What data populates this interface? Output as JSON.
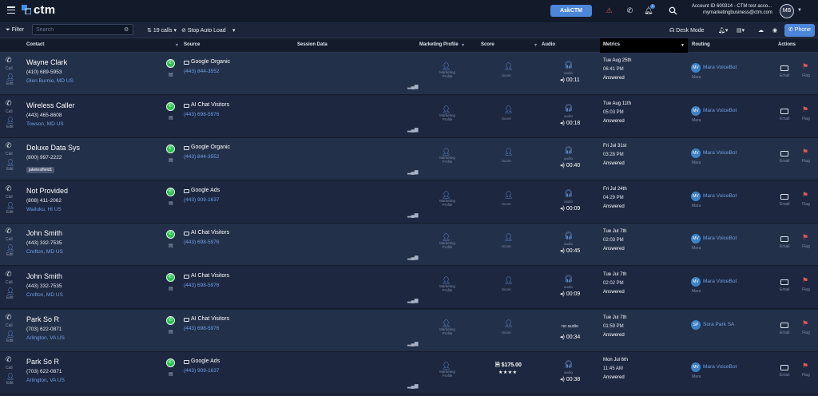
{
  "topbar": {
    "logo_text": "ctm",
    "askctm_label": "AskCTM",
    "notification_count": "1",
    "account_line1": "Account ID 600314 - CTM test acco...",
    "account_line2": "mymarketingbusiness@ctm.com",
    "avatar_initials": "MB"
  },
  "filterbar": {
    "filter_label": "Filter",
    "search_placeholder": "Search",
    "calls_count": "19 calls",
    "stop_auto_load": "Stop Auto Load",
    "desk_mode": "Desk Mode",
    "phone_label": "Phone"
  },
  "columns": {
    "contact": "Contact",
    "source": "Source",
    "session": "Session Data",
    "marketing": "Marketing Profile",
    "score": "Score",
    "audio": "Audio",
    "metrics": "Metrics",
    "routing": "Routing",
    "actions": "Actions"
  },
  "labels": {
    "call": "Call",
    "edit": "Edit",
    "marketing_profile": "Marketing Profile",
    "score": "Score",
    "audio": "audio",
    "no_audio": "no audio",
    "email": "Email",
    "flag": "Flag"
  },
  "rows": [
    {
      "name": "Wayne Clark",
      "phone": "(410) 689-5953",
      "location": "Glen Burnie, MD US",
      "tag": "",
      "source": "Google Organic",
      "source_number": "(443) 844-3552",
      "score_amount": "",
      "has_audio": true,
      "duration": "00:11",
      "date": "Tue Aug 25th",
      "time": "06:41 PM",
      "status": "Answered",
      "routing_initials": "MV",
      "routing_name": "Mara VoiceBot",
      "routing_sub": "Mara"
    },
    {
      "name": "Wireless Caller",
      "phone": "(443) 465-8608",
      "location": "Towson, MD US",
      "tag": "",
      "source": "AI Chat Visitors",
      "source_number": "(443) 698-5976",
      "score_amount": "",
      "has_audio": true,
      "duration": "00:18",
      "date": "Tue Aug 11th",
      "time": "05:03 PM",
      "status": "Answered",
      "routing_initials": "MV",
      "routing_name": "Mara VoiceBot",
      "routing_sub": "Mara"
    },
    {
      "name": "Deluxe Data Sys",
      "phone": "(800) 997-2222",
      "location": "",
      "tag": "jaketestfield1",
      "source": "Google Organic",
      "source_number": "(443) 844-3552",
      "score_amount": "",
      "has_audio": true,
      "duration": "00:40",
      "date": "Fri Jul 31st",
      "time": "03:28 PM",
      "status": "Answered",
      "routing_initials": "MV",
      "routing_name": "Mara VoiceBot",
      "routing_sub": "Mara"
    },
    {
      "name": "Not Provided",
      "phone": "(808) 411-2062",
      "location": "Wailuku, HI US",
      "tag": "",
      "source": "Google Ads",
      "source_number": "(443) 909-1637",
      "score_amount": "",
      "has_audio": true,
      "duration": "00:09",
      "date": "Fri Jul 24th",
      "time": "04:29 PM",
      "status": "Answered",
      "routing_initials": "MV",
      "routing_name": "Mara VoiceBot",
      "routing_sub": "Mara"
    },
    {
      "name": "John Smith",
      "phone": "(443) 332-7535",
      "location": "Crofton, MD US",
      "tag": "",
      "source": "AI Chat Visitors",
      "source_number": "(443) 698-5976",
      "score_amount": "",
      "has_audio": true,
      "duration": "00:45",
      "date": "Tue Jul 7th",
      "time": "02:03 PM",
      "status": "Answered",
      "routing_initials": "MV",
      "routing_name": "Mara VoiceBot",
      "routing_sub": "Mara"
    },
    {
      "name": "John Smith",
      "phone": "(443) 332-7535",
      "location": "Crofton, MD US",
      "tag": "",
      "source": "AI Chat Visitors",
      "source_number": "(443) 698-5976",
      "score_amount": "",
      "has_audio": true,
      "duration": "00:09",
      "date": "Tue Jul 7th",
      "time": "02:02 PM",
      "status": "Answered",
      "routing_initials": "MV",
      "routing_name": "Mara VoiceBot",
      "routing_sub": "Mara"
    },
    {
      "name": "Park So R",
      "phone": "(703) 622-0871",
      "location": "Arlington, VA US",
      "tag": "",
      "source": "AI Chat Visitors",
      "source_number": "(443) 698-5976",
      "score_amount": "",
      "has_audio": false,
      "duration": "00:34",
      "date": "Tue Jul 7th",
      "time": "01:59 PM",
      "status": "Answered",
      "routing_initials": "SP",
      "routing_name": "Sora Park SA",
      "routing_sub": ""
    },
    {
      "name": "Park So R",
      "phone": "(703) 622-0871",
      "location": "Arlington, VA US",
      "tag": "",
      "source": "Google Ads",
      "source_number": "(443) 909-1637",
      "score_amount": "$175.00",
      "stars": "★★★★",
      "has_audio": true,
      "duration": "00:38",
      "date": "Mon Jul 6th",
      "time": "11:45 AM",
      "status": "Answered",
      "routing_initials": "MV",
      "routing_name": "Mara VoiceBot",
      "routing_sub": "Mara"
    }
  ],
  "colors": {
    "accent": "#4c86d8",
    "link": "#6ea0e6",
    "background": "#1b2438",
    "flag": "#e05a5a",
    "whatsapp": "#27c24c"
  }
}
